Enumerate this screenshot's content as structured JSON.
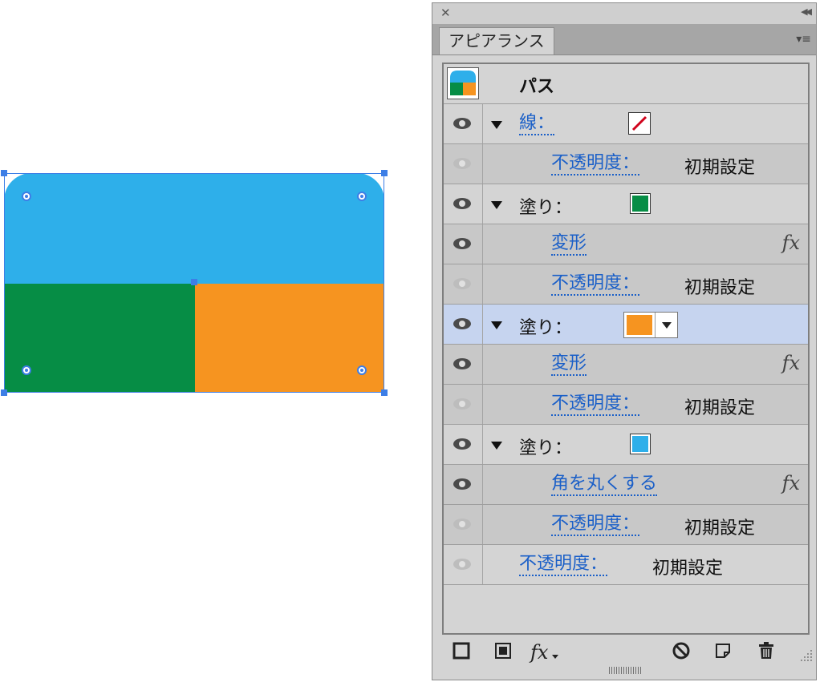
{
  "colors": {
    "blue": "#2eafea",
    "green": "#068d45",
    "orange": "#f69420",
    "selection": "#3d7ee6",
    "link": "#1a5fc8"
  },
  "panel": {
    "title": "アピアランス",
    "header": {
      "label": "パス"
    },
    "rows": [
      {
        "type": "attr",
        "label": "線：",
        "link": true,
        "swatch": "stroke-none"
      },
      {
        "type": "sub",
        "label": "不透明度：",
        "value": "初期設定"
      },
      {
        "type": "attr",
        "label": "塗り：",
        "swatch": "#068d45"
      },
      {
        "type": "sub",
        "label": "変形",
        "fx": "fx"
      },
      {
        "type": "sub",
        "label": "不透明度：",
        "value": "初期設定"
      },
      {
        "type": "attr",
        "label": "塗り：",
        "swatch": "#f69420",
        "selected": true
      },
      {
        "type": "sub",
        "label": "変形",
        "fx": "fx"
      },
      {
        "type": "sub",
        "label": "不透明度：",
        "value": "初期設定"
      },
      {
        "type": "attr",
        "label": "塗り：",
        "swatch": "#2eafea"
      },
      {
        "type": "sub",
        "label": "角を丸くする",
        "fx": "fx"
      },
      {
        "type": "sub",
        "label": "不透明度：",
        "value": "初期設定"
      },
      {
        "type": "obj",
        "label": "不透明度：",
        "value": "初期設定"
      }
    ],
    "footer_fx": "fx"
  }
}
